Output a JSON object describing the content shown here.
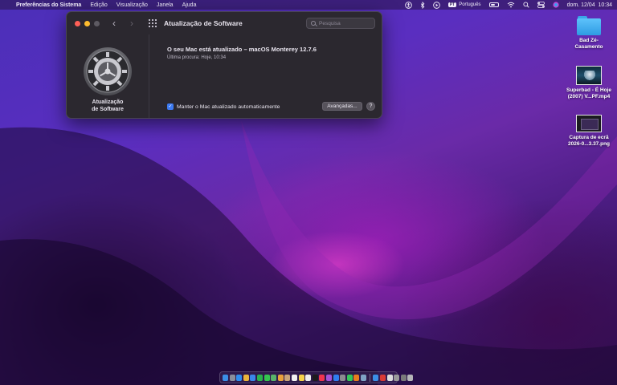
{
  "menubar": {
    "apple_glyph": "",
    "app_name": "Preferências do Sistema",
    "menus": [
      "Edição",
      "Visualização",
      "Janela",
      "Ajuda"
    ],
    "input_source": "Português",
    "input_source_badge": "PT",
    "datetime": "dom. 12/04  10:34"
  },
  "window": {
    "title": "Atualização de Software",
    "search_placeholder": "Pesquisa",
    "sidebar_label": "Atualização\nde Software",
    "status_title": "O seu Mac está atualizado – macOS Monterey 12.7.6",
    "last_check": "Última procura: Hoje, 10:34",
    "auto_update_label": "Manter o Mac atualizado automaticamente",
    "auto_update_checked": true,
    "advanced_button": "Avançadas...",
    "help_button": "?"
  },
  "desktop": {
    "items": [
      {
        "label": "Bad Zé-\nCasamento",
        "icon": "folder-icon"
      },
      {
        "label": "Superbad - É Hoje\n(2007) V...PF.mp4",
        "icon": "video-thumbnail"
      },
      {
        "label": "Captura de ecrã\n2026-0...3.37.png",
        "icon": "image-thumbnail"
      }
    ]
  },
  "dock": {
    "icons": [
      {
        "name": "finder",
        "color": "#3b8fe6"
      },
      {
        "name": "launchpad",
        "color": "#8a8f9c"
      },
      {
        "name": "safari",
        "color": "#2f8ef0"
      },
      {
        "name": "chrome",
        "color": "#e9b43a"
      },
      {
        "name": "mail",
        "color": "#3a86e8"
      },
      {
        "name": "facetime",
        "color": "#2bb24c"
      },
      {
        "name": "messages",
        "color": "#35c54f"
      },
      {
        "name": "maps",
        "color": "#58b36a"
      },
      {
        "name": "photos",
        "color": "#e8a23c"
      },
      {
        "name": "contacts",
        "color": "#c9a67a"
      },
      {
        "name": "calendar",
        "color": "#f2f2f2"
      },
      {
        "name": "notes",
        "color": "#f5d34a"
      },
      {
        "name": "reminders",
        "color": "#eeeeee"
      },
      {
        "name": "tv",
        "color": "#1c1c1c"
      },
      {
        "name": "music",
        "color": "#f0344f"
      },
      {
        "name": "podcasts",
        "color": "#a453d8"
      },
      {
        "name": "app-store",
        "color": "#2f7ef0"
      },
      {
        "name": "system-preferences",
        "color": "#8b8b90"
      },
      {
        "name": "whatsapp",
        "color": "#34c759"
      },
      {
        "name": "vlc",
        "color": "#e87d1e"
      },
      {
        "name": "preview",
        "color": "#7fa3c4"
      },
      {
        "name": "downloads",
        "color": "#3b8fe6"
      },
      {
        "name": "pdf",
        "color": "#d93a35"
      },
      {
        "name": "document",
        "color": "#dcdcdc"
      },
      {
        "name": "screenshot",
        "color": "#9a9a9a"
      },
      {
        "name": "files",
        "color": "#7a7a7a"
      },
      {
        "name": "trash",
        "color": "#b5b5b8"
      }
    ]
  },
  "colors": {
    "accent": "#3d7bf2",
    "window_bg": "#2b282f"
  }
}
